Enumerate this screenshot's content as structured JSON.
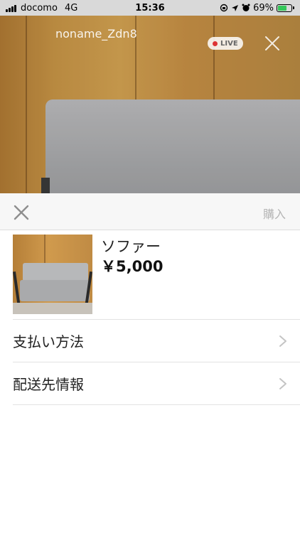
{
  "status_bar": {
    "carrier": "docomo",
    "network": "4G",
    "time": "15:36",
    "battery_percent": "69%",
    "battery_level": 0.69,
    "battery_color": "#34c759"
  },
  "live": {
    "username": "noname_Zdn8",
    "badge_label": "LIVE",
    "badge_dot_color": "#dd3333",
    "close_icon": "close-icon"
  },
  "sheet": {
    "close_icon": "close-icon",
    "buy_label": "購入",
    "product": {
      "name": "ソファー",
      "price": "￥5,000"
    },
    "rows": [
      {
        "label": "支払い方法",
        "icon": "chevron-right-icon"
      },
      {
        "label": "配送先情報",
        "icon": "chevron-right-icon"
      }
    ]
  }
}
